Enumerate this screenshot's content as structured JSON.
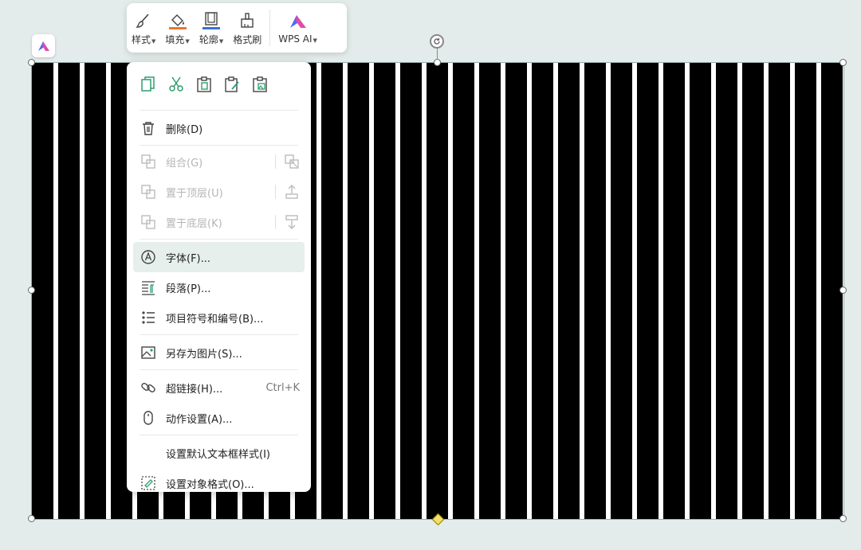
{
  "toolbar": {
    "style_label": "样式",
    "fill_label": "填充",
    "outline_label": "轮廓",
    "format_painter_label": "格式刷",
    "wps_ai_label": "WPS AI"
  },
  "menu": {
    "quick_actions": [
      "copy-icon",
      "cut-icon",
      "paste-icon",
      "paste-keep-format-icon",
      "paste-as-picture-icon"
    ],
    "delete": "删除(D)",
    "group": "组合(G)",
    "bring_to_front": "置于顶层(U)",
    "send_to_back": "置于底层(K)",
    "font": "字体(F)...",
    "paragraph": "段落(P)...",
    "bullets": "项目符号和编号(B)...",
    "save_as_picture": "另存为图片(S)...",
    "hyperlink": "超链接(H)...",
    "hyperlink_shortcut": "Ctrl+K",
    "action_settings": "动作设置(A)...",
    "default_textbox_style": "设置默认文本框样式(I)",
    "format_object": "设置对象格式(O)..."
  },
  "colors": {
    "accent_green": "#2e9e6e",
    "fill_bar": "#e8772e",
    "outline_bar": "#3a6fd8",
    "highlight": "#e6efec",
    "stripe": "#000000"
  }
}
